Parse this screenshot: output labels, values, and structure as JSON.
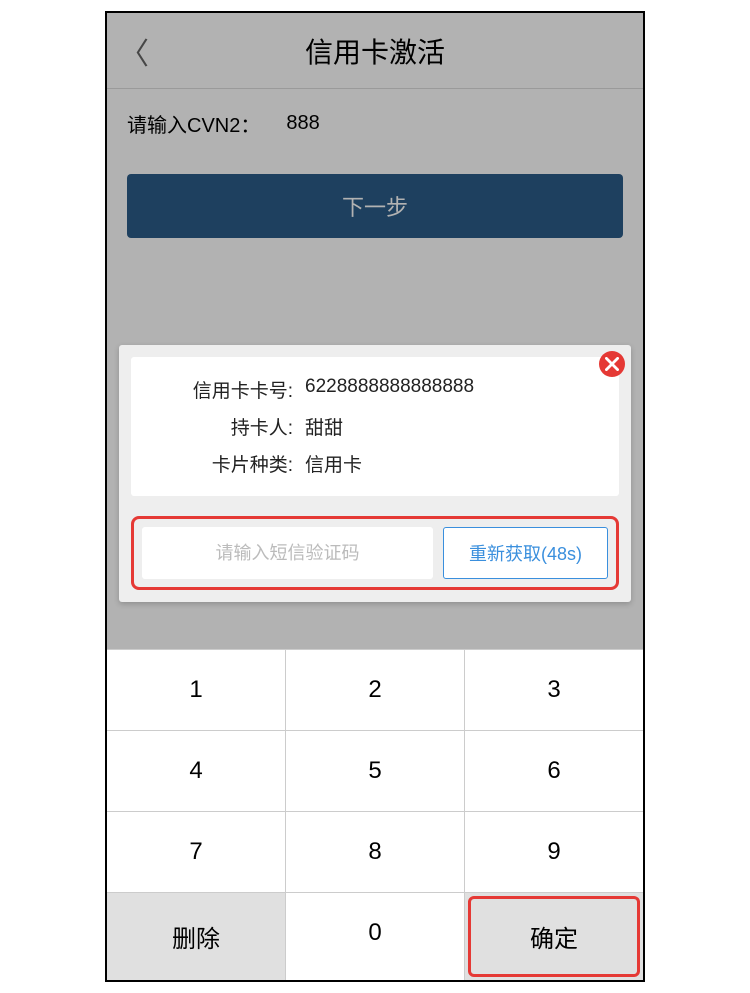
{
  "header": {
    "title": "信用卡激活"
  },
  "cvn": {
    "label": "请输入CVN2：",
    "value": "888"
  },
  "next_button": "下一步",
  "modal": {
    "card_number_label": "信用卡卡号:",
    "card_number_value": "6228888888888888",
    "holder_label": "持卡人:",
    "holder_value": "甜甜",
    "type_label": "卡片种类:",
    "type_value": "信用卡",
    "sms_placeholder": "请输入短信验证码",
    "resend_label": "重新获取(48s)"
  },
  "keypad": {
    "keys": [
      "1",
      "2",
      "3",
      "4",
      "5",
      "6",
      "7",
      "8",
      "9"
    ],
    "delete": "删除",
    "zero": "0",
    "confirm": "确定"
  }
}
